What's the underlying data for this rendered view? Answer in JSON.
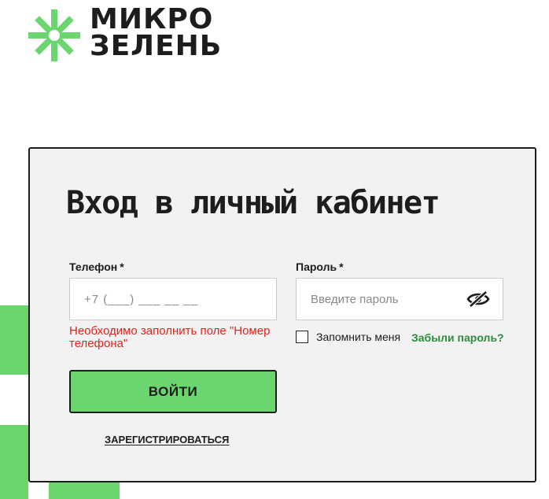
{
  "brand": {
    "line1": "МИКРО",
    "line2": "ЗЕЛЕНЬ",
    "accent_color": "#6bd66f",
    "link_color": "#2e8a3c",
    "error_color": "#e2231a"
  },
  "login": {
    "title": "Вход в личный кабинет",
    "phone": {
      "label": "Телефон",
      "required_mark": "*",
      "placeholder": "+7 (___) ___ __ __",
      "value": "",
      "error": "Необходимо заполнить поле \"Номер телефона\""
    },
    "password": {
      "label": "Пароль",
      "required_mark": "*",
      "placeholder": "Введите пароль",
      "value": "",
      "toggle_icon": "eye-slash-icon"
    },
    "remember": {
      "label": "Запомнить меня",
      "checked": false
    },
    "forgot_label": "Забыли пароль?",
    "submit_label": "ВОЙТИ",
    "register_label": "ЗАРЕГИСТРИРОВАТЬСЯ"
  }
}
